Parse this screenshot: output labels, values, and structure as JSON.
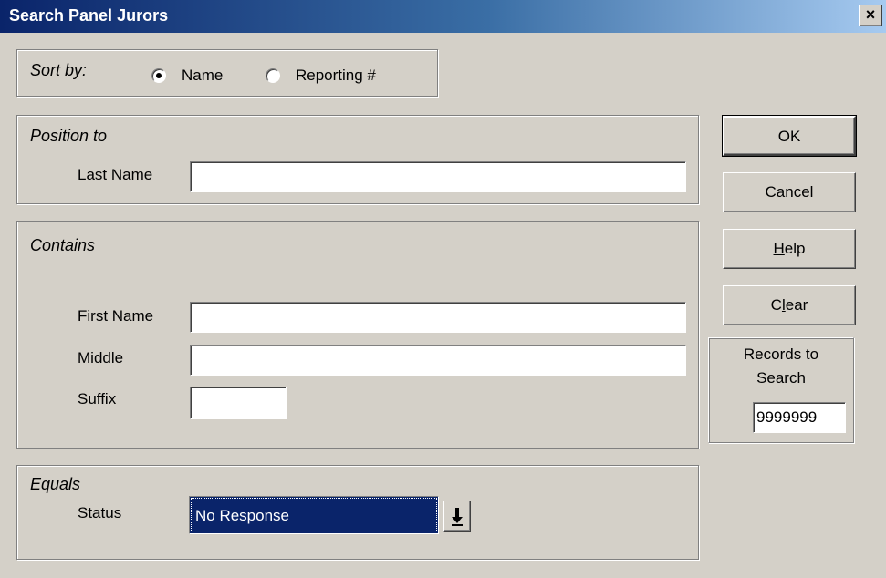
{
  "window": {
    "title": "Search Panel Jurors",
    "close_symbol": "×"
  },
  "sort": {
    "label": "Sort by:",
    "options": [
      {
        "label": "Name",
        "selected": true
      },
      {
        "label": "Reporting #",
        "selected": false
      }
    ]
  },
  "position_to": {
    "title": "Position to",
    "last_name_label": "Last Name",
    "last_name_value": ""
  },
  "contains": {
    "title": "Contains",
    "first_name_label": "First Name",
    "first_name_value": "",
    "middle_label": "Middle",
    "middle_value": "",
    "suffix_label": "Suffix",
    "suffix_value": ""
  },
  "equals": {
    "title": "Equals",
    "status_label": "Status",
    "status_value": "No Response",
    "arrow_icon": "down-arrow-icon"
  },
  "buttons": {
    "ok": "OK",
    "cancel": "Cancel",
    "help_mnemonic": "H",
    "help_rest": "elp",
    "clear_pre": "C",
    "clear_mnemonic": "l",
    "clear_rest": "ear"
  },
  "records": {
    "label_line1": "Records to",
    "label_line2": "Search",
    "value": "9999999"
  },
  "colors": {
    "face": "#d4d0c8",
    "titlebar_start": "#0a246a",
    "selection": "#0a246a"
  }
}
